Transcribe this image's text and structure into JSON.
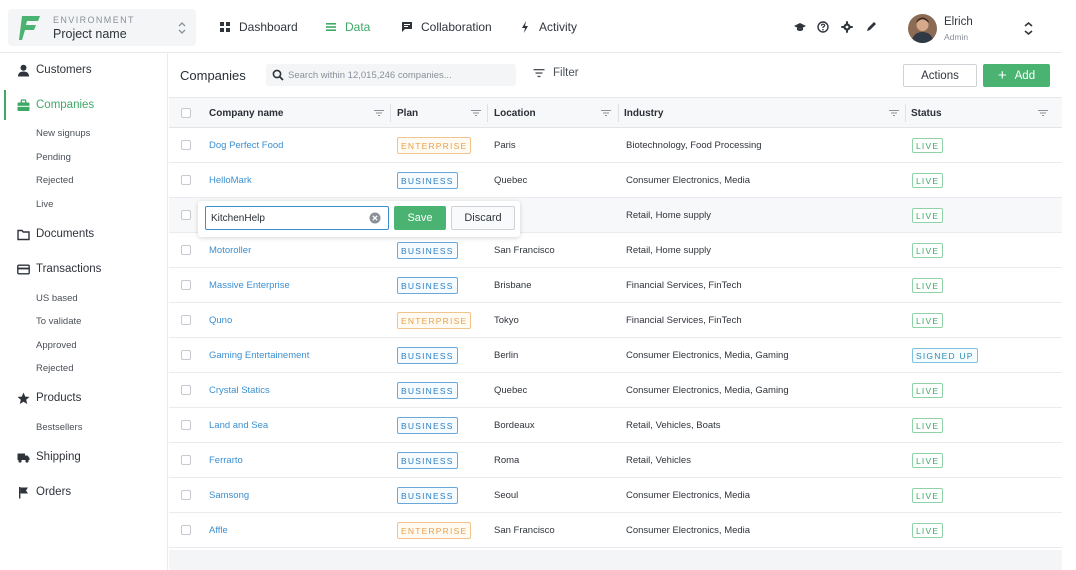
{
  "colors": {
    "accent": "#3ea867",
    "link": "#3b8fd1",
    "enterprise": "#e8a04a",
    "business": "#2d7fc4"
  },
  "environment": {
    "label": "ENVIRONMENT",
    "name": "Project name"
  },
  "nav": [
    {
      "label": "Dashboard",
      "icon": "dashboard-icon",
      "active": false
    },
    {
      "label": "Data",
      "icon": "table-icon",
      "active": true
    },
    {
      "label": "Collaboration",
      "icon": "chat-icon",
      "active": false
    },
    {
      "label": "Activity",
      "icon": "bolt-icon",
      "active": false
    }
  ],
  "tools": [
    "graduation-cap-icon",
    "help-icon",
    "gear-icon",
    "pen-icon"
  ],
  "user": {
    "name": "Elrich",
    "role": "Admin"
  },
  "sidebar": {
    "customers": "Customers",
    "companies": "Companies",
    "companies_sub": [
      "New signups",
      "Pending",
      "Rejected",
      "Live"
    ],
    "documents": "Documents",
    "transactions": "Transactions",
    "transactions_sub": [
      "US based",
      "To validate",
      "Approved",
      "Rejected"
    ],
    "products": "Products",
    "products_sub": [
      "Bestsellers"
    ],
    "shipping": "Shipping",
    "orders": "Orders"
  },
  "toolbar": {
    "title": "Companies",
    "search_placeholder": "Search within 12,015,246 companies...",
    "filter_label": "Filter",
    "actions_label": "Actions",
    "add_label": "Add"
  },
  "table": {
    "columns": [
      "Company name",
      "Plan",
      "Location",
      "Industry",
      "Status"
    ],
    "rows": [
      {
        "name": "Dog Perfect Food",
        "plan": "ENTERPRISE",
        "location": "Paris",
        "industry": "Biotechnology, Food Processing",
        "status": "LIVE"
      },
      {
        "name": "HelloMark",
        "plan": "BUSINESS",
        "location": "Quebec",
        "industry": "Consumer Electronics, Media",
        "status": "LIVE"
      },
      {
        "name": "",
        "plan": "",
        "location": "",
        "industry": "Retail, Home supply",
        "status": "LIVE",
        "editing": true
      },
      {
        "name": "Motoroller",
        "plan": "BUSINESS",
        "location": "San Francisco",
        "industry": "Retail, Home supply",
        "status": "LIVE"
      },
      {
        "name": "Massive Enterprise",
        "plan": "BUSINESS",
        "location": "Brisbane",
        "industry": "Financial Services, FinTech",
        "status": "LIVE"
      },
      {
        "name": "Quno",
        "plan": "ENTERPRISE",
        "location": "Tokyo",
        "industry": "Financial Services, FinTech",
        "status": "LIVE"
      },
      {
        "name": "Gaming Entertainement",
        "plan": "BUSINESS",
        "location": "Berlin",
        "industry": "Consumer Electronics, Media, Gaming",
        "status": "SIGNED UP"
      },
      {
        "name": "Crystal Statics",
        "plan": "BUSINESS",
        "location": "Quebec",
        "industry": "Consumer Electronics, Media, Gaming",
        "status": "LIVE"
      },
      {
        "name": "Land and Sea",
        "plan": "BUSINESS",
        "location": "Bordeaux",
        "industry": "Retail, Vehicles, Boats",
        "status": "LIVE"
      },
      {
        "name": "Ferrarto",
        "plan": "BUSINESS",
        "location": "Roma",
        "industry": "Retail, Vehicles",
        "status": "LIVE"
      },
      {
        "name": "Samsong",
        "plan": "BUSINESS",
        "location": "Seoul",
        "industry": "Consumer Electronics, Media",
        "status": "LIVE"
      },
      {
        "name": "Affle",
        "plan": "ENTERPRISE",
        "location": "San Francisco",
        "industry": "Consumer Electronics, Media",
        "status": "LIVE"
      }
    ]
  },
  "edit": {
    "value": "KitchenHelp",
    "save_label": "Save",
    "discard_label": "Discard"
  }
}
